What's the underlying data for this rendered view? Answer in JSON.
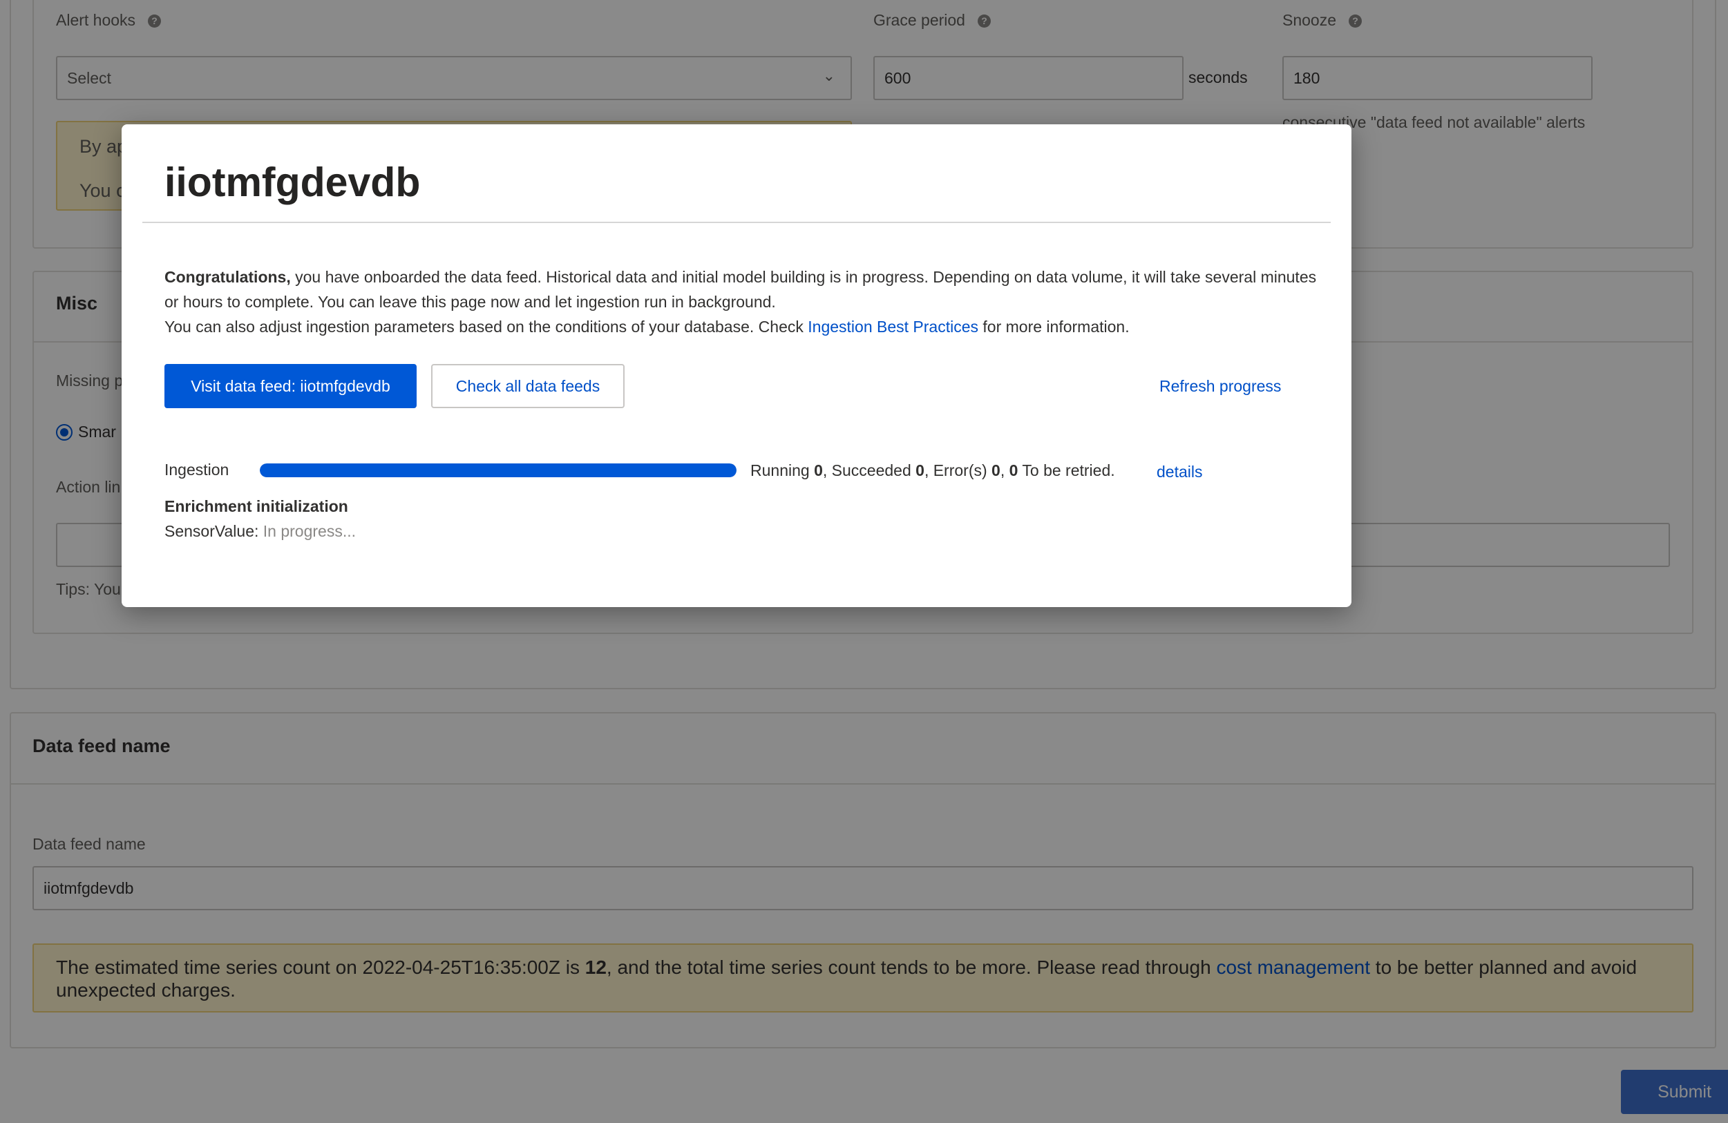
{
  "alerts": {
    "hooks_label": "Alert hooks",
    "hooks_placeholder": "Select",
    "grace_label": "Grace period",
    "grace_value": "600",
    "grace_unit": "seconds",
    "snooze_label": "Snooze",
    "snooze_value": "180",
    "snooze_note": "consecutive \"data feed not available\" alerts",
    "notice_line1": "By ap",
    "notice_line2": "You c"
  },
  "misc": {
    "title": "Misc",
    "missing_label": "Missing p",
    "radio_label": "Smar",
    "action_label": "Action lin",
    "tips": "Tips: You"
  },
  "datafeed": {
    "section_title": "Data feed name",
    "field_label": "Data feed name",
    "field_value": "iiotmfgdevdb",
    "estimate_prefix": "The estimated time series count on 2022-04-25T16:35:00Z is ",
    "estimate_count": "12",
    "estimate_middle": ", and the total time series count tends to be more. Please read through ",
    "estimate_link": "cost management",
    "estimate_suffix": " to be better planned and avoid unexpected charges."
  },
  "submit_label": "Submit",
  "modal": {
    "title": "iiotmfgdevdb",
    "congrats_bold": "Congratulations,",
    "congrats_text": " you have onboarded the data feed. Historical data and initial model building is in progress. Depending on data volume, it will take several minutes or hours to complete. You can leave this page now and let ingestion run in background.",
    "adjust_text": "You can also adjust ingestion parameters based on the conditions of your database. Check ",
    "adjust_link": "Ingestion Best Practices",
    "adjust_suffix": " for more information.",
    "visit_button": "Visit data feed: iiotmfgdevdb",
    "check_all_button": "Check all data feeds",
    "refresh_link": "Refresh progress",
    "ingestion_label": "Ingestion",
    "ingestion_progress": 1.0,
    "status": {
      "running_label": "Running ",
      "running": "0",
      "succeeded_label": ", Succeeded ",
      "succeeded": "0",
      "errors_label": ", Error(s) ",
      "errors": "0",
      "sep": ", ",
      "retry": "0",
      "retry_label": " To be retried."
    },
    "details_link": "details",
    "enrichment_title": "Enrichment initialization",
    "enrichment_key": "SensorValue:",
    "enrichment_status": " In progress..."
  },
  "colors": {
    "primary": "#0058d6",
    "link": "#0050c8",
    "overlay": "rgba(0,0,0,0.46)"
  }
}
